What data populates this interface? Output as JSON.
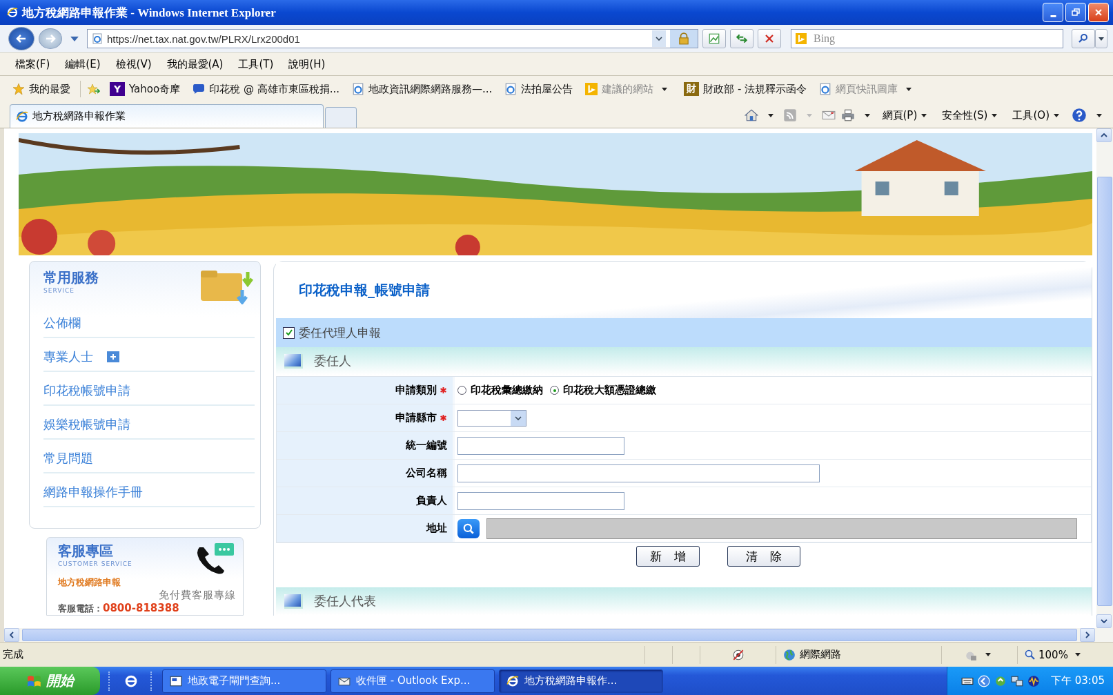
{
  "window": {
    "title": "地方稅網路申報作業 - Windows Internet Explorer"
  },
  "address_bar": {
    "url": "https://net.tax.nat.gov.tw/PLRX/Lrx200d01"
  },
  "search": {
    "placeholder": "Bing"
  },
  "menu": [
    "檔案(F)",
    "編輯(E)",
    "檢視(V)",
    "我的最愛(A)",
    "工具(T)",
    "說明(H)"
  ],
  "favorites": {
    "label": "我的最愛",
    "items": [
      {
        "label": "Yahoo奇摩",
        "kind": "letter",
        "letter": "Y",
        "color": "#400090",
        "greyed": false,
        "dropdown": false
      },
      {
        "label": "印花稅 @ 高雄市東區稅捐...",
        "kind": "chat",
        "greyed": false,
        "dropdown": false
      },
      {
        "label": "地政資訊網際網路服務—...",
        "kind": "ie",
        "greyed": false,
        "dropdown": false
      },
      {
        "label": "法拍屋公告",
        "kind": "ie",
        "greyed": false,
        "dropdown": false
      },
      {
        "label": "建議的網站",
        "kind": "bing",
        "greyed": true,
        "dropdown": true
      },
      {
        "label": "財政部 - 法規釋示函令",
        "kind": "letter",
        "letter": "財",
        "color": "#8a6a10",
        "greyed": false,
        "dropdown": false
      },
      {
        "label": "網頁快訊圖庫",
        "kind": "ie",
        "greyed": true,
        "dropdown": true
      }
    ]
  },
  "tab": {
    "label": "地方稅網路申報作業"
  },
  "command_bar": [
    "網頁(P)",
    "安全性(S)",
    "工具(O)"
  ],
  "sidebar": {
    "title": "常用服務",
    "subtitle": "SERVICE",
    "items": [
      {
        "label": "公佈欄",
        "expandable": false
      },
      {
        "label": "專業人士",
        "expandable": true
      },
      {
        "label": "印花稅帳號申請",
        "expandable": false
      },
      {
        "label": "娛樂稅帳號申請",
        "expandable": false
      },
      {
        "label": "常見問題",
        "expandable": false
      },
      {
        "label": "網路申報操作手冊",
        "expandable": false
      }
    ]
  },
  "service_box": {
    "title": "客服專區",
    "subtitle": "CUSTOMER SERVICE",
    "line_1": "地方稅網路申報",
    "line_2": "免付費客服專線",
    "phone_label": "客服電話：",
    "phone": "0800-818388"
  },
  "main": {
    "title": "印花稅申報_帳號申請",
    "agent": {
      "label": "委任代理人申報",
      "checked": true
    },
    "section_1": "委任人",
    "rows": [
      {
        "label": "申請類別",
        "required": true,
        "kind": "radio",
        "options": [
          {
            "label": "印花稅彙總繳納",
            "selected": false
          },
          {
            "label": "印花稅大額憑證總繳",
            "selected": true
          }
        ]
      },
      {
        "label": "申請縣市",
        "required": true,
        "kind": "select"
      },
      {
        "label": "統一編號",
        "required": false,
        "kind": "text",
        "wide": false
      },
      {
        "label": "公司名稱",
        "required": false,
        "kind": "text",
        "wide": true
      },
      {
        "label": "負責人",
        "required": false,
        "kind": "text",
        "wide": false
      },
      {
        "label": "地址",
        "required": false,
        "kind": "address"
      }
    ],
    "buttons": [
      "新 增",
      "清 除"
    ],
    "section_2": "委任人代表"
  },
  "status_bar": {
    "text": "完成",
    "zone": "網際網路",
    "zoom": "100%"
  },
  "taskbar": {
    "start": "開始",
    "tasks": [
      {
        "label": "地政電子閘門查詢...",
        "kind": "doc",
        "selected": false
      },
      {
        "label": "收件匣 - Outlook Exp...",
        "kind": "mail",
        "selected": false
      },
      {
        "label": "地方稅網路申報作...",
        "kind": "ie",
        "selected": true
      }
    ],
    "clock": "下午 03:05"
  }
}
